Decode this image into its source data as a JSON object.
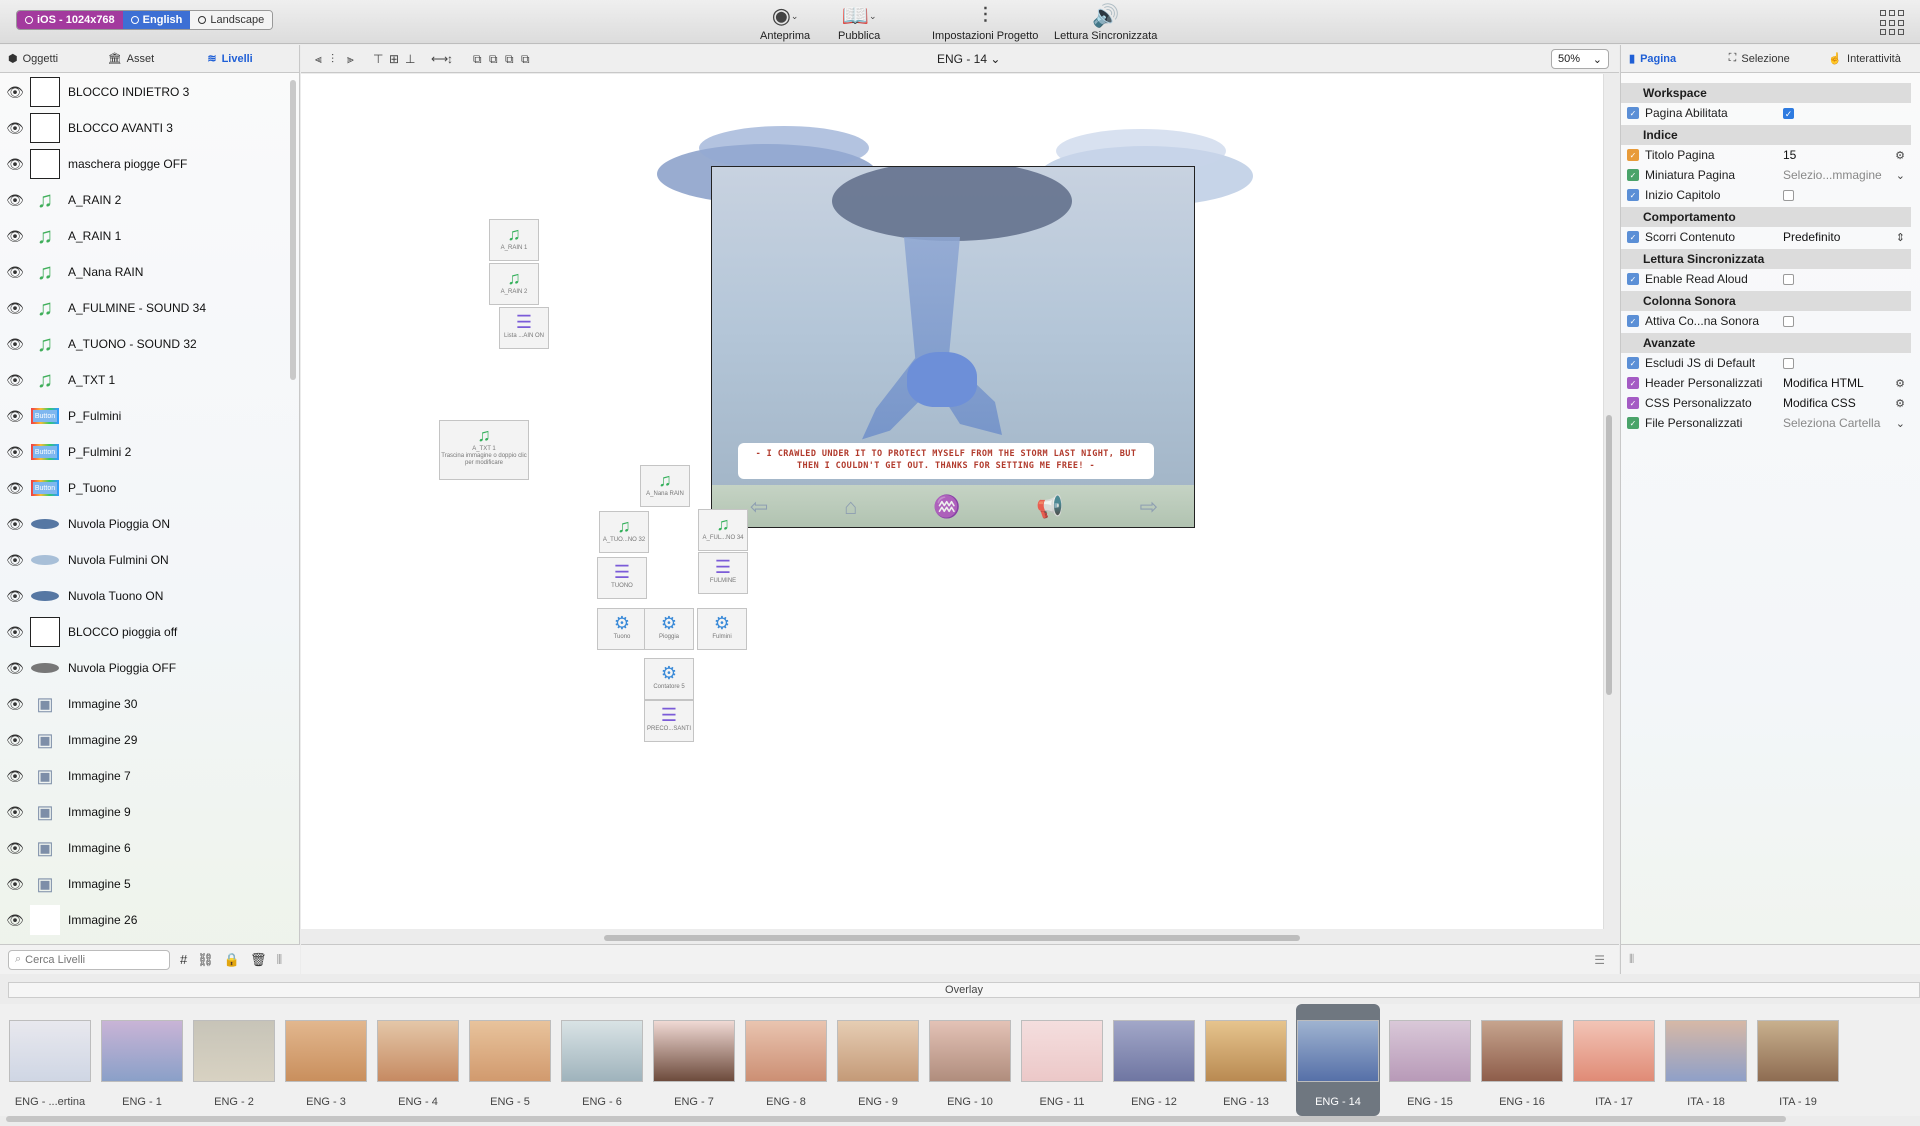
{
  "toolbar": {
    "device": "iOS - 1024x768",
    "language": "English",
    "orientation": "Landscape",
    "buttons": [
      {
        "label": "Anteprima"
      },
      {
        "label": "Pubblica"
      },
      {
        "label": "Impostazioni Progetto"
      },
      {
        "label": "Lettura Sincronizzata"
      }
    ]
  },
  "left_panel": {
    "tabs": [
      "Oggetti",
      "Asset",
      "Livelli"
    ],
    "active_tab": "Livelli",
    "layers": [
      {
        "name": "BLOCCO INDIETRO 3",
        "thumb": "box"
      },
      {
        "name": "BLOCCO AVANTI 3",
        "thumb": "box"
      },
      {
        "name": "maschera piogge OFF",
        "thumb": "box"
      },
      {
        "name": "A_RAIN 2",
        "thumb": "music"
      },
      {
        "name": "A_RAIN 1",
        "thumb": "music"
      },
      {
        "name": "A_Nana RAIN",
        "thumb": "music"
      },
      {
        "name": "A_FULMINE - SOUND 34",
        "thumb": "music"
      },
      {
        "name": "A_TUONO - SOUND 32",
        "thumb": "music"
      },
      {
        "name": "A_TXT 1",
        "thumb": "music"
      },
      {
        "name": "P_Fulmini",
        "thumb": "button"
      },
      {
        "name": "P_Fulmini 2",
        "thumb": "button"
      },
      {
        "name": "P_Tuono",
        "thumb": "button"
      },
      {
        "name": "Nuvola Pioggia ON",
        "thumb": "cloud"
      },
      {
        "name": "Nuvola Fulmini ON",
        "thumb": "cloud-light"
      },
      {
        "name": "Nuvola Tuono ON",
        "thumb": "cloud"
      },
      {
        "name": "BLOCCO pioggia off",
        "thumb": "box"
      },
      {
        "name": "Nuvola Pioggia OFF",
        "thumb": "cloud-grey"
      },
      {
        "name": "Immagine 30",
        "thumb": "img"
      },
      {
        "name": "Immagine 29",
        "thumb": "img"
      },
      {
        "name": "Immagine 7",
        "thumb": "img"
      },
      {
        "name": "Immagine 9",
        "thumb": "img"
      },
      {
        "name": "Immagine 6",
        "thumb": "img"
      },
      {
        "name": "Immagine 5",
        "thumb": "img"
      },
      {
        "name": "Immagine 26",
        "thumb": "white"
      }
    ],
    "search_placeholder": "Cerca Livelli",
    "thumb_button_label": "Button"
  },
  "canvas_header": {
    "page": "ENG - 14",
    "zoom": "50%"
  },
  "page_art": {
    "speech_text": "- I CRAWLED UNDER IT TO PROTECT MYSELF FROM THE STORM LAST NIGHT, BUT THEN I COULDN'T GET OUT. THANKS FOR SETTING ME FREE! -"
  },
  "canvas_objects": [
    {
      "label": "A_RAIN 1",
      "icon": "music"
    },
    {
      "label": "A_RAIN 2",
      "icon": "music"
    },
    {
      "label": "Lista ...AIN ON",
      "icon": "list"
    },
    {
      "label": "A_TXT 1",
      "sub": "Trascina immagine o doppio clic per modificare",
      "icon": "music"
    },
    {
      "label": "A_Nana RAIN",
      "icon": "music"
    },
    {
      "label": "A_TUO...NO 32",
      "icon": "music"
    },
    {
      "label": "A_FUL...NO 34",
      "icon": "music"
    },
    {
      "label": "TUONO",
      "icon": "list"
    },
    {
      "label": "FULMINE",
      "icon": "list"
    },
    {
      "label": "Tuono",
      "icon": "gear"
    },
    {
      "label": "Pioggia",
      "icon": "gear"
    },
    {
      "label": "Fulmini",
      "icon": "gear"
    },
    {
      "label": "Contatore 5",
      "icon": "gear"
    },
    {
      "label": "PRECO...SANTI",
      "icon": "list"
    }
  ],
  "right_panel": {
    "tabs": [
      "Pagina",
      "Selezione",
      "Interattività"
    ],
    "active_tab": "Pagina",
    "sections": [
      {
        "title": "Workspace",
        "rows": [
          {
            "label": "Pagina Abilitata",
            "type": "check",
            "checked": true,
            "icon_color": "#5b8fd6"
          }
        ]
      },
      {
        "title": "Indice",
        "rows": [
          {
            "label": "Titolo Pagina",
            "type": "text",
            "value": "15",
            "icon_color": "#e89b3a"
          },
          {
            "label": "Miniatura Pagina",
            "type": "select",
            "value": "Selezio...mmagine",
            "icon_color": "#4aa36a"
          },
          {
            "label": "Inizio Capitolo",
            "type": "check",
            "checked": false,
            "icon_color": "#5b8fd6"
          }
        ]
      },
      {
        "title": "Comportamento",
        "rows": [
          {
            "label": "Scorri Contenuto",
            "type": "stepper",
            "value": "Predefinito",
            "icon_color": "#5b8fd6"
          }
        ]
      },
      {
        "title": "Lettura Sincronizzata",
        "rows": [
          {
            "label": "Enable Read Aloud",
            "type": "check",
            "checked": false,
            "icon_color": "#5b8fd6"
          }
        ]
      },
      {
        "title": "Colonna Sonora",
        "rows": [
          {
            "label": "Attiva Co...na Sonora",
            "type": "check",
            "checked": false,
            "icon_color": "#5b8fd6"
          }
        ]
      },
      {
        "title": "Avanzate",
        "rows": [
          {
            "label": "Escludi JS di Default",
            "type": "check",
            "checked": false,
            "icon_color": "#5b8fd6"
          },
          {
            "label": "Header Personalizzati",
            "type": "text",
            "value": "Modifica HTML",
            "icon_color": "#a45bc4"
          },
          {
            "label": "CSS Personalizzato",
            "type": "text",
            "value": "Modifica CSS",
            "icon_color": "#a45bc4"
          },
          {
            "label": "File Personalizzati",
            "type": "select",
            "value": "Seleziona Cartella",
            "icon_color": "#4aa36a"
          }
        ]
      }
    ]
  },
  "overlay_label": "Overlay",
  "pages": [
    {
      "label": "ENG - ...ertina",
      "c1": "#e8e8ee",
      "c2": "#cfd6e4"
    },
    {
      "label": "ENG - 1",
      "c1": "#c9b4d6",
      "c2": "#8aa0c8"
    },
    {
      "label": "ENG - 2",
      "c1": "#c7c4b8",
      "c2": "#d8d2c2"
    },
    {
      "label": "ENG - 3",
      "c1": "#e2b78e",
      "c2": "#c98f5d"
    },
    {
      "label": "ENG - 4",
      "c1": "#e4c7a8",
      "c2": "#c68a62"
    },
    {
      "label": "ENG - 5",
      "c1": "#e8c39c",
      "c2": "#d19a6e"
    },
    {
      "label": "ENG - 6",
      "c1": "#d9e3e5",
      "c2": "#9fb3bc"
    },
    {
      "label": "ENG - 7",
      "c1": "#f0d9d4",
      "c2": "#6d4b3c"
    },
    {
      "label": "ENG - 8",
      "c1": "#e9c4b0",
      "c2": "#cc8f74"
    },
    {
      "label": "ENG - 9",
      "c1": "#e6cdb3",
      "c2": "#c49a78"
    },
    {
      "label": "ENG - 10",
      "c1": "#e3c2b6",
      "c2": "#b08d7d"
    },
    {
      "label": "ENG - 11",
      "c1": "#f4dede",
      "c2": "#ecc8c8"
    },
    {
      "label": "ENG - 12",
      "c1": "#a2a7c8",
      "c2": "#6f76a2"
    },
    {
      "label": "ENG - 13",
      "c1": "#e6c48e",
      "c2": "#b98a52"
    },
    {
      "label": "ENG - 14",
      "c1": "#9fb3d0",
      "c2": "#5670a8"
    },
    {
      "label": "ENG - 15",
      "c1": "#d9c8d8",
      "c2": "#b89ab8"
    },
    {
      "label": "ENG - 16",
      "c1": "#c6a48e",
      "c2": "#8e5d4a"
    },
    {
      "label": "ITA - 17",
      "c1": "#f2c4b6",
      "c2": "#e08b76"
    },
    {
      "label": "ITA - 18",
      "c1": "#d6b8a6",
      "c2": "#8fa0c8"
    },
    {
      "label": "ITA - 19",
      "c1": "#c8b08e",
      "c2": "#8e6c52"
    }
  ],
  "selected_page": "ENG - 14"
}
